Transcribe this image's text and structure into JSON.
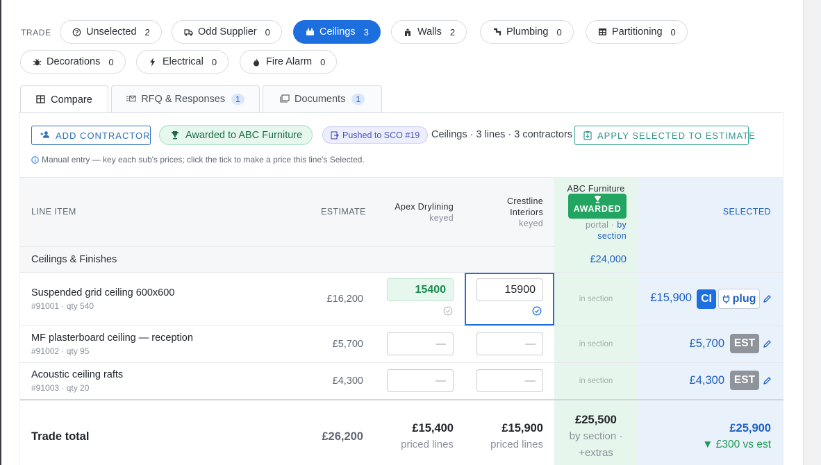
{
  "trade": {
    "label": "TRADE",
    "pills": [
      {
        "label": "Unselected",
        "count": "2",
        "icon": "help-circle-icon"
      },
      {
        "label": "Odd Supplier",
        "count": "0",
        "icon": "truck-icon"
      },
      {
        "label": "Ceilings",
        "count": "3",
        "icon": "ceiling-icon",
        "active": true
      },
      {
        "label": "Walls",
        "count": "2",
        "icon": "wall-icon"
      },
      {
        "label": "Plumbing",
        "count": "0",
        "icon": "pipe-icon"
      },
      {
        "label": "Partitioning",
        "count": "0",
        "icon": "partition-icon"
      },
      {
        "label": "Decorations",
        "count": "0",
        "icon": "bug-icon"
      },
      {
        "label": "Electrical",
        "count": "0",
        "icon": "bolt-icon"
      },
      {
        "label": "Fire Alarm",
        "count": "0",
        "icon": "flame-icon"
      }
    ]
  },
  "tabs": [
    {
      "label": "Compare",
      "icon": "grid-icon",
      "active": true
    },
    {
      "label": "RFQ & Responses",
      "badge": "1",
      "icon": "mail-list-icon"
    },
    {
      "label": "Documents",
      "badge": "1",
      "icon": "documents-icon"
    }
  ],
  "toolbar": {
    "add_contractor": "ADD CONTRACTOR",
    "awarded": "Awarded to ABC Furniture",
    "pushed": "Pushed to SCO #19",
    "summary": "Ceilings · 3 lines · 3 contractors",
    "apply": "APPLY SELECTED TO ESTIMATE"
  },
  "hint": "Manual entry — key each sub's prices; click the tick to make a price this line's Selected.",
  "columns": {
    "line_item": "LINE ITEM",
    "estimate": "ESTIMATE",
    "apex": {
      "name": "Apex Drylining",
      "sub": "keyed"
    },
    "crestline": {
      "name_1": "Crestline",
      "name_2": "Interiors",
      "sub": "keyed"
    },
    "abc": {
      "name": "ABC Furniture",
      "badge": "AWARDED",
      "sub_1": "portal · ",
      "sub_link_1": "by",
      "sub_link_2": "section"
    },
    "selected": "SELECTED"
  },
  "section": {
    "name": "Ceilings & Finishes",
    "abc_total": "£24,000"
  },
  "rows": [
    {
      "name": "Suspended grid ceiling 600x600",
      "meta": "#91001 · qty 540",
      "estimate": "£16,200",
      "apex": "15400",
      "crestline": "15900",
      "abc": "in section",
      "selected": "£15,900",
      "tag": "CI",
      "plug": "plug"
    },
    {
      "name": "MF plasterboard ceiling — reception",
      "meta": "#91002 · qty 95",
      "estimate": "£5,700",
      "apex": "—",
      "crestline": "—",
      "abc": "in section",
      "selected": "£5,700",
      "tag": "EST"
    },
    {
      "name": "Acoustic ceiling rafts",
      "meta": "#91003 · qty 20",
      "estimate": "£4,300",
      "apex": "—",
      "crestline": "—",
      "abc": "in section",
      "selected": "£4,300",
      "tag": "EST"
    }
  ],
  "totals": {
    "label": "Trade total",
    "estimate": "£26,200",
    "apex": "£15,400",
    "apex_sub": "priced lines",
    "crestline": "£15,900",
    "crestline_sub": "priced lines",
    "abc": "£25,500",
    "abc_sub_1": "by section ·",
    "abc_sub_2": "+extras",
    "selected": "£25,900",
    "variance": "▼ £300 vs est"
  },
  "colors": {
    "accent": "#1d6fe0",
    "awarded": "#23a562",
    "teal": "#35a396"
  }
}
